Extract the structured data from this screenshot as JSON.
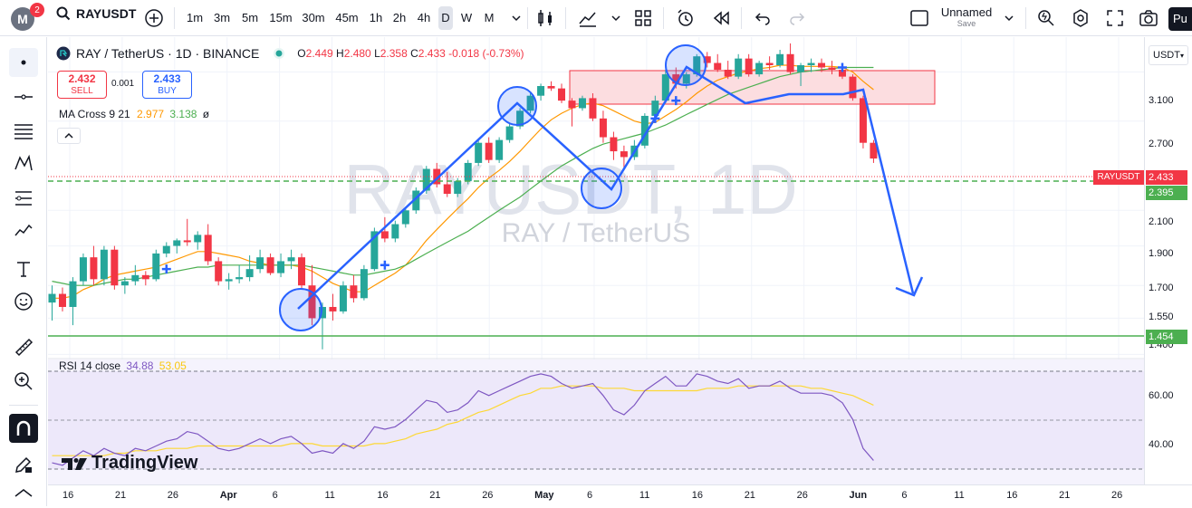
{
  "topbar": {
    "avatar_letter": "M",
    "notification_count": "2",
    "symbol": "RAYUSDT",
    "intervals": [
      "1m",
      "3m",
      "5m",
      "15m",
      "30m",
      "45m",
      "1h",
      "2h",
      "4h",
      "D",
      "W",
      "M"
    ],
    "active_interval": "D",
    "layout_name": "Unnamed",
    "layout_save": "Save",
    "publish_label": "Pu"
  },
  "legend": {
    "title": "RAY / TetherUS · 1D · BINANCE",
    "open_label": "O",
    "open": "2.449",
    "high_label": "H",
    "high": "2.480",
    "low_label": "L",
    "low": "2.358",
    "close_label": "C",
    "close": "2.433",
    "change": "-0.018 (-0.73%)"
  },
  "trade": {
    "sell_price": "2.432",
    "sell_label": "SELL",
    "spread": "0.001",
    "buy_price": "2.433",
    "buy_label": "BUY"
  },
  "indicators": {
    "ma_name": "MA Cross 9 21",
    "ma_fast": "2.977",
    "ma_slow": "3.138",
    "ma_extra": "ø",
    "rsi_name": "RSI 14 close",
    "rsi_value": "34.88",
    "rsi_ma": "53.05"
  },
  "watermark": {
    "symbol": "RAYUSDT, 1D",
    "description": "RAY / TetherUS"
  },
  "brand": "TradingView",
  "price_axis": {
    "currency": "USDT",
    "ticks": [
      "3.100",
      "2.700",
      "2.100",
      "1.900",
      "1.700",
      "1.550",
      "1.400"
    ],
    "current_label": "RAYUSDT",
    "current_price": "2.433",
    "support_price": "2.395",
    "low_price": "1.454",
    "rsi_ticks": [
      "60.00",
      "40.00"
    ]
  },
  "time_axis": {
    "ticks": [
      "16",
      "21",
      "26",
      "Apr",
      "6",
      "11",
      "16",
      "21",
      "26",
      "May",
      "6",
      "11",
      "16",
      "21",
      "26",
      "Jun",
      "6",
      "11",
      "16",
      "21",
      "26"
    ]
  },
  "colors": {
    "up": "#26a69a",
    "down": "#f23645",
    "ma_fast": "#ff9800",
    "ma_slow": "#4caf50",
    "drawing": "#2962ff",
    "rsi_line": "#7e57c2",
    "rsi_ma": "#fdd835"
  },
  "chart_data": {
    "type": "candlestick",
    "candles": [
      [
        1.62,
        1.7,
        1.54,
        1.66
      ],
      [
        1.66,
        1.69,
        1.58,
        1.6
      ],
      [
        1.6,
        1.74,
        1.52,
        1.72
      ],
      [
        1.72,
        1.86,
        1.7,
        1.84
      ],
      [
        1.84,
        1.9,
        1.7,
        1.73
      ],
      [
        1.73,
        1.9,
        1.7,
        1.88
      ],
      [
        1.88,
        1.9,
        1.68,
        1.7
      ],
      [
        1.7,
        1.74,
        1.66,
        1.72
      ],
      [
        1.72,
        1.8,
        1.7,
        1.75
      ],
      [
        1.75,
        1.77,
        1.7,
        1.73
      ],
      [
        1.73,
        1.88,
        1.72,
        1.86
      ],
      [
        1.86,
        1.92,
        1.84,
        1.9
      ],
      [
        1.9,
        1.94,
        1.86,
        1.93
      ],
      [
        1.93,
        2.05,
        1.9,
        1.92
      ],
      [
        1.92,
        1.98,
        1.88,
        1.96
      ],
      [
        1.96,
        2.02,
        1.8,
        1.82
      ],
      [
        1.82,
        1.84,
        1.7,
        1.72
      ],
      [
        1.72,
        1.76,
        1.68,
        1.73
      ],
      [
        1.73,
        1.8,
        1.71,
        1.74
      ],
      [
        1.74,
        1.85,
        1.72,
        1.78
      ],
      [
        1.78,
        1.88,
        1.76,
        1.84
      ],
      [
        1.84,
        1.86,
        1.75,
        1.76
      ],
      [
        1.76,
        1.86,
        1.74,
        1.82
      ],
      [
        1.82,
        1.88,
        1.78,
        1.84
      ],
      [
        1.84,
        1.86,
        1.68,
        1.7
      ],
      [
        1.7,
        1.8,
        1.52,
        1.55
      ],
      [
        1.55,
        1.62,
        1.42,
        1.6
      ],
      [
        1.6,
        1.66,
        1.54,
        1.58
      ],
      [
        1.58,
        1.72,
        1.57,
        1.7
      ],
      [
        1.7,
        1.75,
        1.62,
        1.64
      ],
      [
        1.64,
        1.8,
        1.63,
        1.78
      ],
      [
        1.78,
        2.0,
        1.77,
        1.98
      ],
      [
        1.98,
        2.06,
        1.92,
        1.94
      ],
      [
        1.94,
        2.04,
        1.92,
        2.02
      ],
      [
        2.02,
        2.12,
        2.0,
        2.1
      ],
      [
        2.1,
        2.24,
        2.08,
        2.22
      ],
      [
        2.22,
        2.38,
        2.2,
        2.36
      ],
      [
        2.36,
        2.4,
        2.24,
        2.26
      ],
      [
        2.26,
        2.34,
        2.18,
        2.2
      ],
      [
        2.2,
        2.3,
        2.18,
        2.28
      ],
      [
        2.28,
        2.42,
        2.26,
        2.4
      ],
      [
        2.4,
        2.56,
        2.38,
        2.54
      ],
      [
        2.54,
        2.58,
        2.4,
        2.42
      ],
      [
        2.42,
        2.58,
        2.4,
        2.56
      ],
      [
        2.56,
        2.68,
        2.54,
        2.66
      ],
      [
        2.66,
        2.8,
        2.64,
        2.78
      ],
      [
        2.78,
        2.92,
        2.76,
        2.9
      ],
      [
        2.9,
        3.0,
        2.86,
        2.98
      ],
      [
        2.98,
        3.02,
        2.94,
        2.96
      ],
      [
        2.96,
        3.0,
        2.84,
        2.86
      ],
      [
        2.86,
        2.88,
        2.66,
        2.8
      ],
      [
        2.8,
        2.9,
        2.78,
        2.88
      ],
      [
        2.88,
        2.92,
        2.7,
        2.72
      ],
      [
        2.72,
        2.78,
        2.54,
        2.58
      ],
      [
        2.58,
        2.62,
        2.42,
        2.48
      ],
      [
        2.48,
        2.52,
        2.36,
        2.44
      ],
      [
        2.44,
        2.56,
        2.42,
        2.52
      ],
      [
        2.52,
        2.76,
        2.5,
        2.74
      ],
      [
        2.74,
        2.9,
        2.7,
        2.86
      ],
      [
        2.86,
        3.12,
        2.84,
        3.08
      ],
      [
        3.08,
        3.14,
        2.96,
        3.0
      ],
      [
        3.0,
        3.1,
        2.96,
        3.08
      ],
      [
        3.08,
        3.26,
        3.06,
        3.24
      ],
      [
        3.24,
        3.28,
        3.14,
        3.18
      ],
      [
        3.18,
        3.26,
        3.1,
        3.12
      ],
      [
        3.12,
        3.2,
        3.04,
        3.06
      ],
      [
        3.06,
        3.26,
        3.04,
        3.22
      ],
      [
        3.22,
        3.26,
        3.06,
        3.08
      ],
      [
        3.08,
        3.2,
        3.06,
        3.18
      ],
      [
        3.18,
        3.24,
        3.12,
        3.16
      ],
      [
        3.16,
        3.3,
        3.14,
        3.26
      ],
      [
        3.26,
        3.36,
        3.08,
        3.1
      ],
      [
        3.1,
        3.18,
        2.98,
        3.16
      ],
      [
        3.16,
        3.22,
        3.1,
        3.18
      ],
      [
        3.18,
        3.22,
        3.1,
        3.14
      ],
      [
        3.14,
        3.2,
        3.08,
        3.12
      ],
      [
        3.12,
        3.16,
        3.04,
        3.06
      ],
      [
        3.06,
        3.08,
        2.86,
        2.88
      ],
      [
        2.88,
        2.9,
        2.5,
        2.54
      ],
      [
        2.54,
        2.56,
        2.4,
        2.43
      ]
    ],
    "ma_fast": [
      1.64,
      1.64,
      1.65,
      1.68,
      1.7,
      1.73,
      1.75,
      1.76,
      1.77,
      1.78,
      1.79,
      1.81,
      1.83,
      1.85,
      1.87,
      1.87,
      1.86,
      1.85,
      1.84,
      1.82,
      1.81,
      1.8,
      1.8,
      1.8,
      1.79,
      1.77,
      1.74,
      1.71,
      1.69,
      1.67,
      1.67,
      1.7,
      1.73,
      1.76,
      1.8,
      1.86,
      1.93,
      1.99,
      2.05,
      2.11,
      2.17,
      2.24,
      2.3,
      2.35,
      2.41,
      2.48,
      2.56,
      2.64,
      2.71,
      2.76,
      2.8,
      2.83,
      2.84,
      2.82,
      2.78,
      2.74,
      2.7,
      2.68,
      2.69,
      2.74,
      2.79,
      2.85,
      2.92,
      2.98,
      3.03,
      3.06,
      3.09,
      3.11,
      3.13,
      3.14,
      3.16,
      3.16,
      3.15,
      3.15,
      3.15,
      3.15,
      3.14,
      3.1,
      3.02,
      2.95
    ],
    "ma_slow": [
      1.72,
      1.71,
      1.7,
      1.7,
      1.7,
      1.71,
      1.72,
      1.73,
      1.73,
      1.74,
      1.75,
      1.76,
      1.77,
      1.78,
      1.79,
      1.79,
      1.8,
      1.8,
      1.8,
      1.8,
      1.8,
      1.8,
      1.8,
      1.8,
      1.8,
      1.79,
      1.78,
      1.77,
      1.76,
      1.75,
      1.75,
      1.76,
      1.77,
      1.78,
      1.8,
      1.83,
      1.86,
      1.89,
      1.92,
      1.95,
      1.98,
      2.02,
      2.06,
      2.1,
      2.14,
      2.18,
      2.23,
      2.28,
      2.33,
      2.38,
      2.42,
      2.46,
      2.5,
      2.53,
      2.55,
      2.57,
      2.59,
      2.61,
      2.64,
      2.67,
      2.71,
      2.75,
      2.79,
      2.83,
      2.87,
      2.91,
      2.94,
      2.97,
      3.0,
      3.03,
      3.06,
      3.08,
      3.1,
      3.11,
      3.12,
      3.13,
      3.14,
      3.14,
      3.14,
      3.14
    ],
    "rsi": [
      35,
      34,
      37,
      40,
      38,
      41,
      39,
      38,
      41,
      40,
      42,
      44,
      45,
      48,
      47,
      44,
      41,
      40,
      41,
      43,
      45,
      43,
      45,
      46,
      43,
      39,
      40,
      39,
      43,
      41,
      44,
      50,
      49,
      50,
      53,
      57,
      61,
      60,
      56,
      57,
      60,
      65,
      63,
      65,
      67,
      69,
      71,
      72,
      71,
      68,
      66,
      67,
      68,
      63,
      57,
      55,
      59,
      65,
      68,
      71,
      67,
      67,
      72,
      71,
      69,
      68,
      70,
      66,
      67,
      67,
      69,
      66,
      64,
      64,
      64,
      63,
      60,
      53,
      41,
      36
    ],
    "rsi_ma": [
      38,
      38,
      38,
      38,
      38,
      38,
      39,
      39,
      40,
      40,
      40,
      41,
      41,
      41,
      42,
      42,
      42,
      42,
      42,
      42,
      42,
      42,
      42,
      43,
      43,
      43,
      42,
      42,
      42,
      42,
      42,
      43,
      43,
      44,
      45,
      47,
      48,
      49,
      51,
      52,
      54,
      56,
      57,
      59,
      61,
      63,
      64,
      66,
      66,
      67,
      67,
      67,
      67,
      66,
      66,
      66,
      65,
      65,
      65,
      65,
      65,
      65,
      65,
      66,
      66,
      66,
      67,
      67,
      67,
      67,
      67,
      67,
      67,
      66,
      66,
      65,
      64,
      63,
      61,
      59
    ],
    "ylim": [
      1.38,
      3.42
    ],
    "rsi_ylim": [
      26,
      78
    ]
  }
}
